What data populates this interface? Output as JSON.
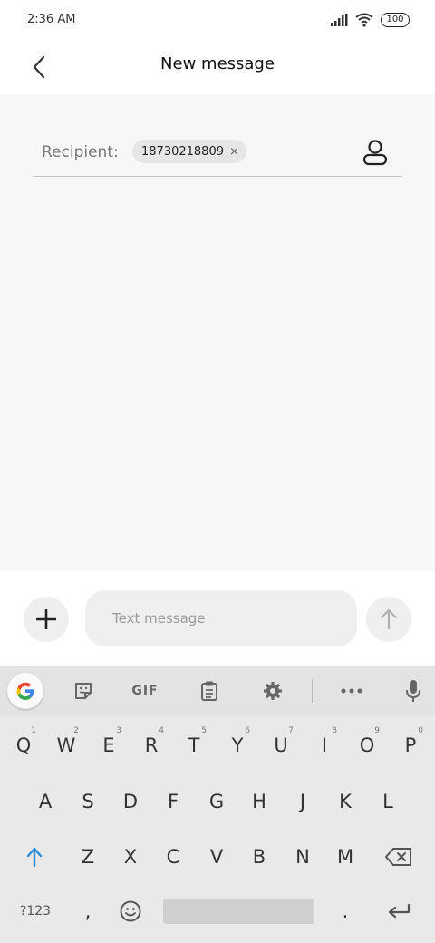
{
  "status": {
    "time": "2:36 AM",
    "battery": "100"
  },
  "header": {
    "title": "New message",
    "back_icon": "chevron-left-icon"
  },
  "recipient": {
    "label": "Recipient:",
    "chip": "18730218809",
    "chip_close": "×"
  },
  "compose": {
    "placeholder": "Text message",
    "value": ""
  },
  "keyboard": {
    "row1": [
      {
        "k": "Q",
        "h": "1"
      },
      {
        "k": "W",
        "h": "2"
      },
      {
        "k": "E",
        "h": "3"
      },
      {
        "k": "R",
        "h": "4"
      },
      {
        "k": "T",
        "h": "5"
      },
      {
        "k": "Y",
        "h": "6"
      },
      {
        "k": "U",
        "h": "7"
      },
      {
        "k": "I",
        "h": "8"
      },
      {
        "k": "O",
        "h": "9"
      },
      {
        "k": "P",
        "h": "0"
      }
    ],
    "row2": [
      "A",
      "S",
      "D",
      "F",
      "G",
      "H",
      "J",
      "K",
      "L"
    ],
    "row3": [
      "Z",
      "X",
      "C",
      "V",
      "B",
      "N",
      "M"
    ],
    "symbols_label": "?123",
    "comma": ",",
    "period": ".",
    "gif_label": "GIF"
  },
  "colors": {
    "accent": "#2a8bd8",
    "background": "#f7f7f7",
    "keyboard": "#e9e9e9"
  }
}
